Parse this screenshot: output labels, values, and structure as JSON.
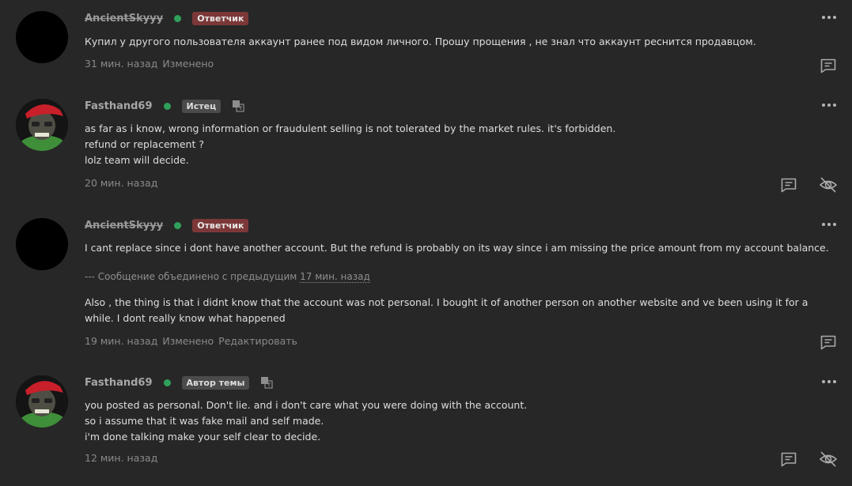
{
  "posts": [
    {
      "username": "AncientSkyyy",
      "badge": "Ответчик",
      "lines": [
        "Купил у другого пользователя аккаунт ранее под видом личного. Прошу прощения , не знал что аккаунт реснится продавцом."
      ],
      "time": "31 мин. назад",
      "edited": "Изменено"
    },
    {
      "username": "Fasthand69",
      "badge": "Истец",
      "lines": [
        "as far as i know, wrong information or fraudulent selling is not tolerated by the market rules. it's forbidden.",
        "refund or replacement ?",
        "lolz team will decide."
      ],
      "time": "20 мин. назад"
    },
    {
      "username": "AncientSkyyy",
      "badge": "Ответчик",
      "line1": "I cant replace since i dont have another account. But the refund is probably on its way since i am missing the price amount from my account balance.",
      "merged_prefix": "--- Сообщение объединено с предыдущим",
      "merged_time": "17 мин. назад",
      "line2": "Also , the thing is that i didnt know that the account was not personal. I bought it of another person on another website and ve been using it for a while. I dont really know what happened",
      "time": "19 мин. назад",
      "edited": "Изменено",
      "edit": "Редактировать"
    },
    {
      "username": "Fasthand69",
      "badge": "Автор темы",
      "lines": [
        "you posted as personal. Don't lie. and i don't care what you were doing with the account.",
        "so i assume that it was fake mail and self made.",
        "i'm done talking make your self clear to decide."
      ],
      "time": "12 мин. назад"
    }
  ],
  "colors": {
    "background": "#272727",
    "online": "#2fa05a",
    "badge_red": "#7c3838",
    "badge_gray": "#4b4b4b"
  },
  "icons": {
    "reply": "reply-icon",
    "hide": "eye-off-icon",
    "translate": "translate-icon",
    "menu": "more-dots-icon"
  }
}
